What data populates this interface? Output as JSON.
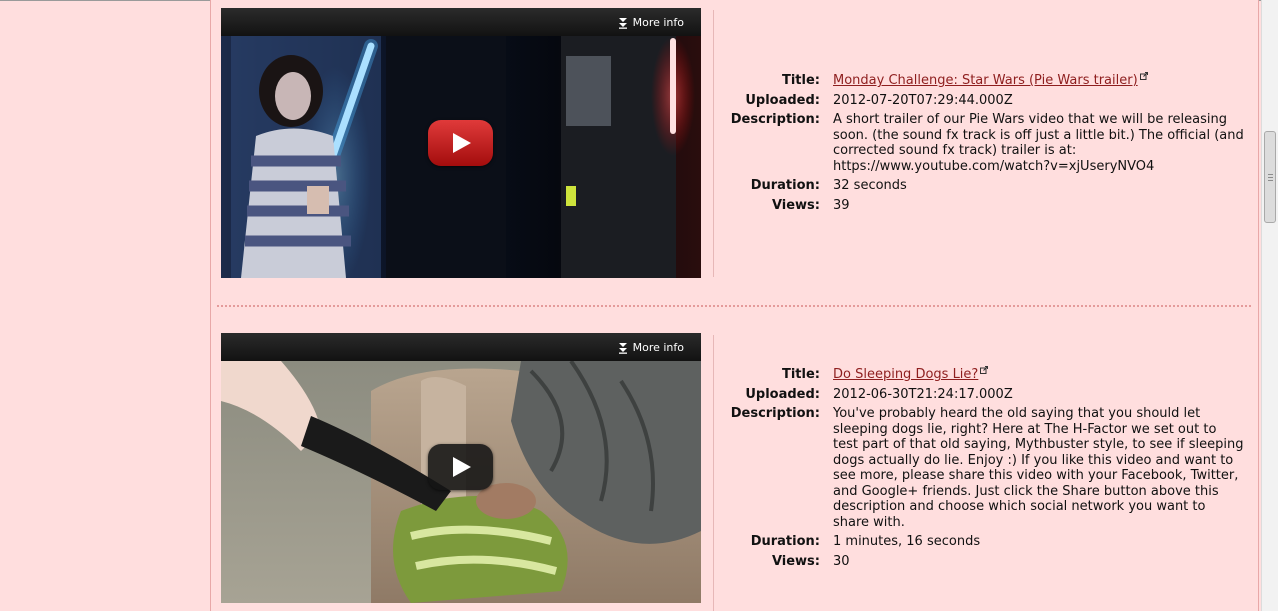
{
  "videos": [
    {
      "more_info": "More info",
      "labels": {
        "title": "Title:",
        "uploaded": "Uploaded:",
        "description": "Description:",
        "duration": "Duration:",
        "views": "Views:"
      },
      "title": "Monday Challenge: Star Wars (Pie Wars trailer)",
      "uploaded": "2012-07-20T07:29:44.000Z",
      "description": "A short trailer of our Pie Wars video that we will be releasing soon. (the sound fx track is off just a little bit.) The official (and corrected sound fx track) trailer is at: https://www.youtube.com/watch?v=xjUseryNVO4",
      "duration": "32 seconds",
      "views": "39",
      "play_button_color": "#cc1f1f"
    },
    {
      "more_info": "More info",
      "labels": {
        "title": "Title:",
        "uploaded": "Uploaded:",
        "description": "Description:",
        "duration": "Duration:",
        "views": "Views:"
      },
      "title": "Do Sleeping Dogs Lie?",
      "uploaded": "2012-06-30T21:24:17.000Z",
      "description": "You've probably heard the old saying that you should let sleeping dogs lie, right? Here at The H-Factor we set out to test part of that old saying, Mythbuster style, to see if sleeping dogs actually do lie. Enjoy :) If you like this video and want to see more, please share this video with your Facebook, Twitter, and Google+ friends. Just click the Share button above this description and choose which social network you want to share with.",
      "duration": "1 minutes, 16 seconds",
      "views": "30",
      "play_button_color": "#1a1a1a"
    }
  ],
  "colors": {
    "page_background": "#ffdede",
    "link": "#8e1e1e",
    "divider": "#e49b9b"
  }
}
